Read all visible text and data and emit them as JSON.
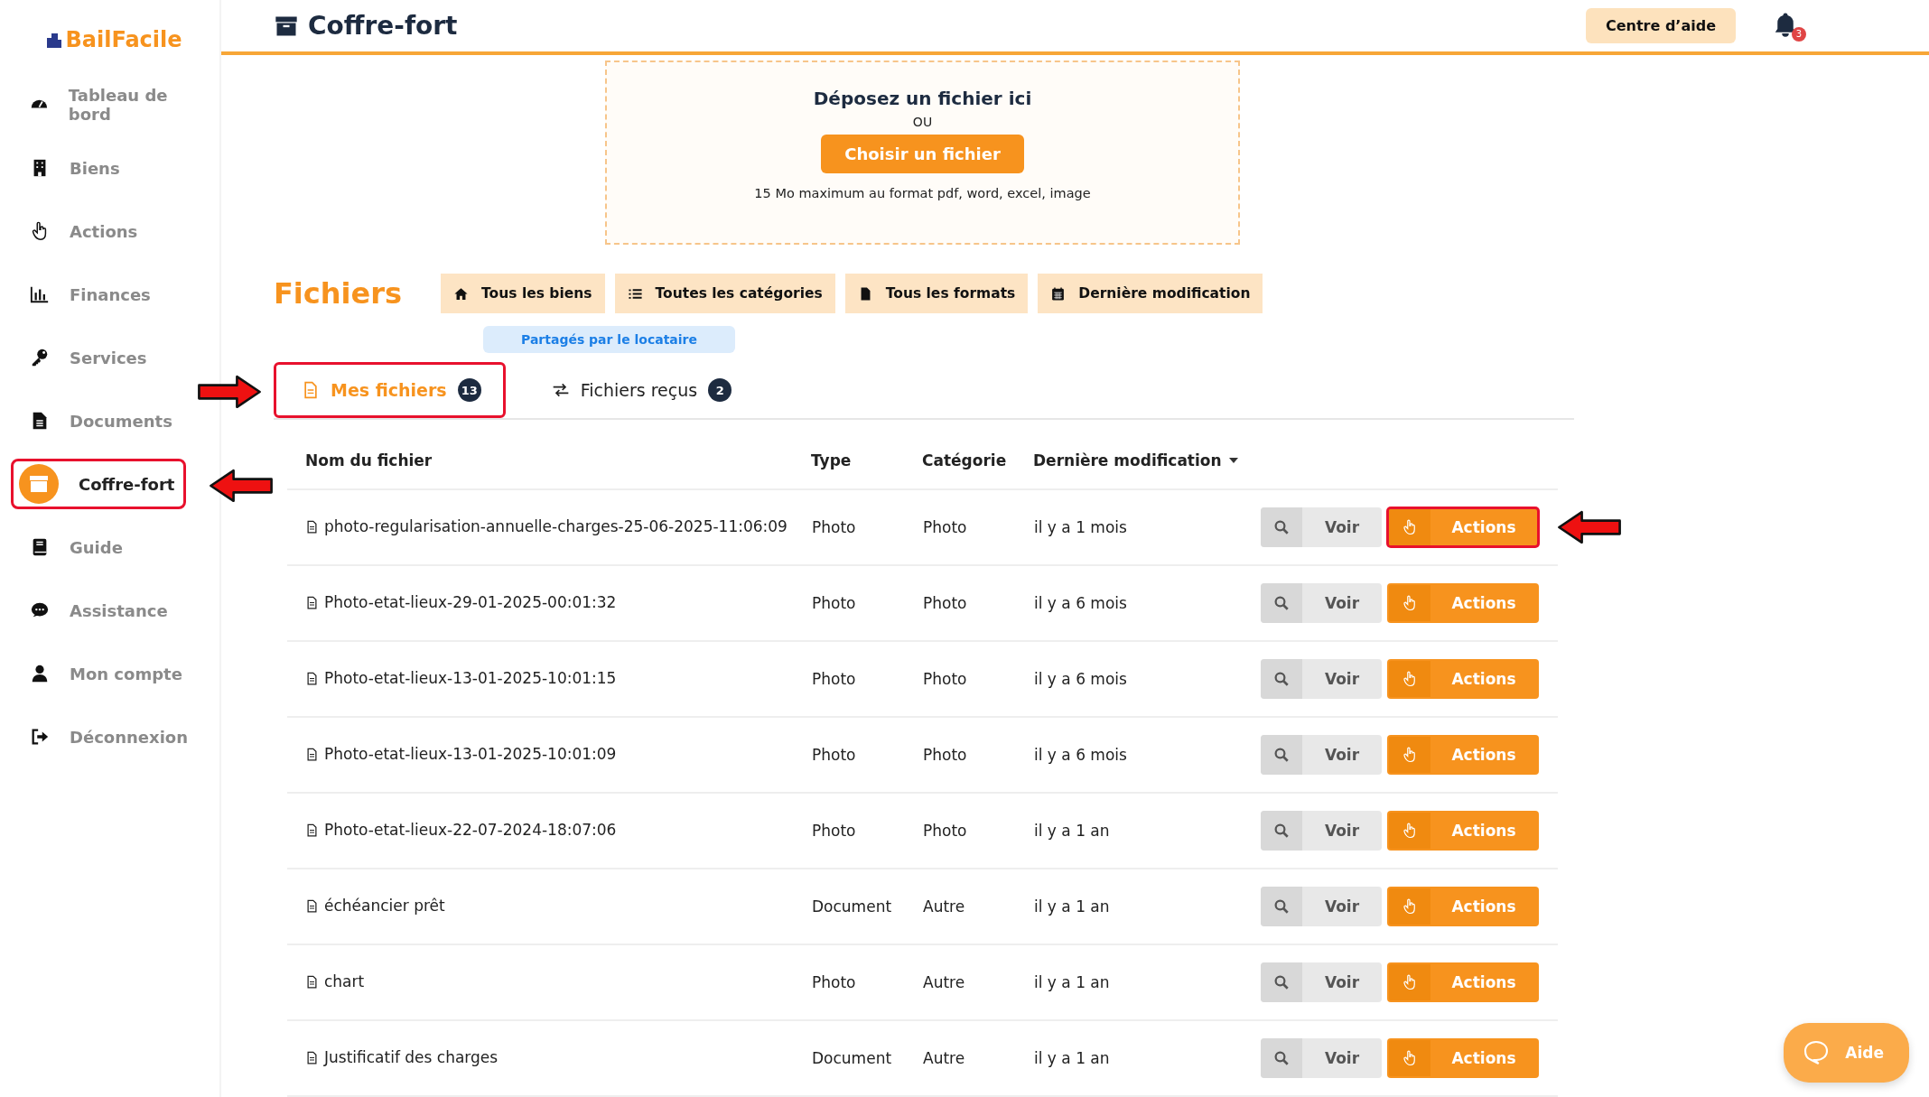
{
  "sidebar": {
    "logo": "BailFacile",
    "items": [
      {
        "kind": "gauge",
        "label": "Tableau de bord",
        "selected": false,
        "highlighted": false
      },
      {
        "kind": "building",
        "label": "Biens",
        "selected": false,
        "highlighted": false
      },
      {
        "kind": "hand",
        "label": "Actions",
        "selected": false,
        "highlighted": false
      },
      {
        "kind": "chart",
        "label": "Finances",
        "selected": false,
        "highlighted": false
      },
      {
        "kind": "key",
        "label": "Services",
        "selected": false,
        "highlighted": false
      },
      {
        "kind": "document",
        "label": "Documents",
        "selected": false,
        "highlighted": false
      },
      {
        "kind": "archive",
        "label": "Coffre-fort",
        "selected": true,
        "highlighted": true
      },
      {
        "kind": "book",
        "label": "Guide",
        "selected": false,
        "highlighted": false
      },
      {
        "kind": "chat",
        "label": "Assistance",
        "selected": false,
        "highlighted": false
      },
      {
        "kind": "user",
        "label": "Mon compte",
        "selected": false,
        "highlighted": false
      },
      {
        "kind": "logout",
        "label": "Déconnexion",
        "selected": false,
        "highlighted": false
      }
    ]
  },
  "header": {
    "title": "Coffre-fort",
    "help_button": "Centre d’aide",
    "notification_count": "3"
  },
  "upload": {
    "title": "Déposez un fichier ici",
    "separator": "OU",
    "button": "Choisir un fichier",
    "hint": "15 Mo maximum au format pdf, word, excel, image"
  },
  "files": {
    "heading": "Fichiers",
    "filters": [
      {
        "kind": "home",
        "label": "Tous les biens"
      },
      {
        "kind": "list",
        "label": "Toutes les catégories"
      },
      {
        "kind": "file",
        "label": "Tous les formats"
      },
      {
        "kind": "calendar",
        "label": "Dernière modification"
      }
    ],
    "shared_filter": "Partagés par le locataire",
    "tabs": [
      {
        "kind": "file",
        "label": "Mes fichiers",
        "count": "13",
        "selected": true,
        "highlighted": true
      },
      {
        "kind": "exchange",
        "label": "Fichiers reçus",
        "count": "2",
        "selected": false,
        "highlighted": false
      }
    ]
  },
  "table": {
    "columns": [
      {
        "label": "Nom du fichier",
        "sorted": false
      },
      {
        "label": "Type",
        "sorted": false
      },
      {
        "label": "Catégorie",
        "sorted": false
      },
      {
        "label": "Dernière modification",
        "sorted": true
      }
    ],
    "rows": [
      {
        "name": "photo-regularisation-annuelle-charges-25-06-2025-11:06:09",
        "type": "Photo",
        "category": "Photo",
        "modified": "il y a 1 mois",
        "view": "Voir",
        "actions": "Actions",
        "highlighted": true
      },
      {
        "name": "Photo-etat-lieux-29-01-2025-00:01:32",
        "type": "Photo",
        "category": "Photo",
        "modified": "il y a 6 mois",
        "view": "Voir",
        "actions": "Actions",
        "highlighted": false
      },
      {
        "name": "Photo-etat-lieux-13-01-2025-10:01:15",
        "type": "Photo",
        "category": "Photo",
        "modified": "il y a 6 mois",
        "view": "Voir",
        "actions": "Actions",
        "highlighted": false
      },
      {
        "name": "Photo-etat-lieux-13-01-2025-10:01:09",
        "type": "Photo",
        "category": "Photo",
        "modified": "il y a 6 mois",
        "view": "Voir",
        "actions": "Actions",
        "highlighted": false
      },
      {
        "name": "Photo-etat-lieux-22-07-2024-18:07:06",
        "type": "Photo",
        "category": "Photo",
        "modified": "il y a 1 an",
        "view": "Voir",
        "actions": "Actions",
        "highlighted": false
      },
      {
        "name": "échéancier prêt",
        "type": "Document",
        "category": "Autre",
        "modified": "il y a 1 an",
        "view": "Voir",
        "actions": "Actions",
        "highlighted": false
      },
      {
        "name": "chart",
        "type": "Photo",
        "category": "Autre",
        "modified": "il y a 1 an",
        "view": "Voir",
        "actions": "Actions",
        "highlighted": false
      },
      {
        "name": "Justificatif des charges",
        "type": "Document",
        "category": "Autre",
        "modified": "il y a 1 an",
        "view": "Voir",
        "actions": "Actions",
        "highlighted": false
      }
    ]
  },
  "help_widget": {
    "label": "Aide"
  }
}
